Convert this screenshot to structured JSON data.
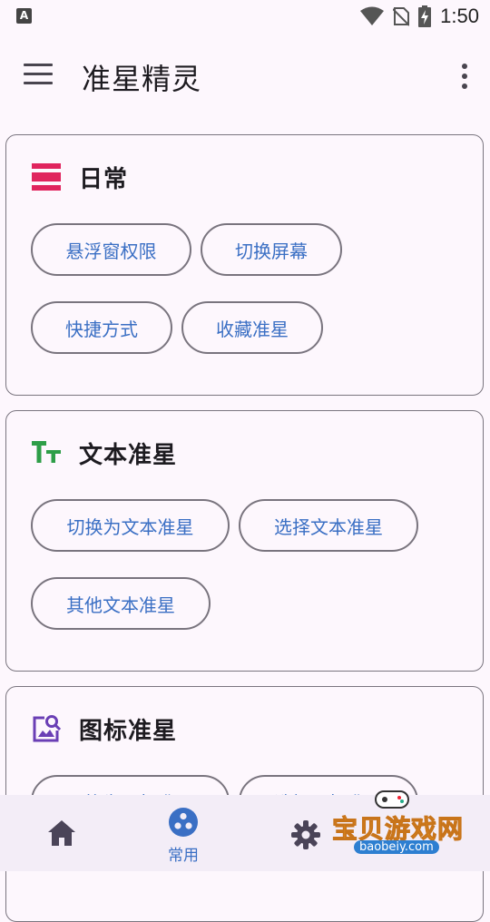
{
  "status_bar": {
    "time": "1:50",
    "notification_glyph": "A"
  },
  "app_bar": {
    "title": "准星精灵"
  },
  "cards": [
    {
      "title": "日常",
      "icon": "daily-list-icon",
      "chips": [
        "悬浮窗权限",
        "切换屏幕",
        "快捷方式",
        "收藏准星"
      ]
    },
    {
      "title": "文本准星",
      "icon": "text-format-icon",
      "chips": [
        "切换为文本准星",
        "选择文本准星",
        "其他文本准星"
      ]
    },
    {
      "title": "图标准星",
      "icon": "image-search-icon",
      "chips": [
        "切换为图标准星",
        "选择图标准星"
      ]
    }
  ],
  "bottom_nav": {
    "home_label": "",
    "common_label": "常用",
    "settings_label": ""
  },
  "watermark": {
    "text": "宝贝游戏网",
    "url": "baobeiy.com"
  },
  "colors": {
    "accent_text": "#3a6fc4",
    "daily_icon": "#e0245e",
    "text_icon": "#2e9e48",
    "image_icon": "#6a3fb5",
    "background": "#fdf7fd"
  }
}
